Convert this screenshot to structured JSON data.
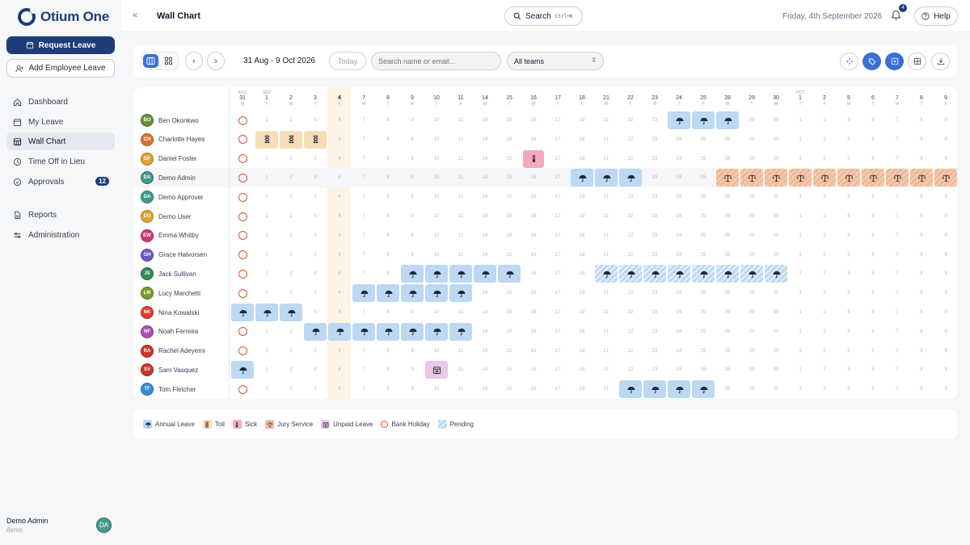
{
  "app": {
    "name": "Otium One"
  },
  "sidebar": {
    "request_leave": "Request Leave",
    "add_employee_leave": "Add Employee Leave",
    "nav": [
      {
        "id": "dashboard",
        "label": "Dashboard",
        "icon": "home-icon"
      },
      {
        "id": "my-leave",
        "label": "My Leave",
        "icon": "calendar-icon"
      },
      {
        "id": "wall-chart",
        "label": "Wall Chart",
        "icon": "calendar-grid-icon",
        "active": true
      },
      {
        "id": "toil",
        "label": "Time Off in Lieu",
        "icon": "clock-icon"
      },
      {
        "id": "approvals",
        "label": "Approvals",
        "icon": "check-circle-icon",
        "badge": "12"
      },
      {
        "id": "reports",
        "label": "Reports",
        "icon": "document-icon"
      },
      {
        "id": "administration",
        "label": "Administration",
        "icon": "sliders-icon"
      }
    ],
    "user": {
      "name": "Demo Admin",
      "sub": "demo",
      "initials": "DA"
    }
  },
  "header": {
    "title": "Wall Chart",
    "search_label": "Search",
    "search_shortcut": "Ctrl+K",
    "date": "Friday, 4th September 2026",
    "notification_count": "4",
    "help_label": "Help"
  },
  "toolbar": {
    "range": "31 Aug - 9 Oct 2026",
    "today": "Today",
    "search_placeholder": "Search name or email...",
    "team_select": "All teams"
  },
  "colors": {
    "primary": "#1d3c78",
    "accent": "#3a6fd6",
    "annual": "#bcd8f3",
    "toil": "#f7ddb5",
    "sick": "#f4a9bb",
    "jury": "#f6c9ad",
    "unpaid": "#e7c9e6",
    "bank_holiday": "#d9562c",
    "today_column": "#fdf2e3"
  },
  "days": [
    {
      "mon": "AUG",
      "d": "31",
      "w": "M",
      "bh": true
    },
    {
      "mon": "SEP",
      "d": "1",
      "w": "T"
    },
    {
      "mon": "",
      "d": "2",
      "w": "W"
    },
    {
      "mon": "",
      "d": "3",
      "w": "T"
    },
    {
      "mon": "",
      "d": "4",
      "w": "F",
      "today": true
    },
    {
      "mon": "",
      "d": "7",
      "w": "M"
    },
    {
      "mon": "",
      "d": "8",
      "w": "T"
    },
    {
      "mon": "",
      "d": "9",
      "w": "W"
    },
    {
      "mon": "",
      "d": "10",
      "w": "T"
    },
    {
      "mon": "",
      "d": "11",
      "w": "F"
    },
    {
      "mon": "",
      "d": "14",
      "w": "M"
    },
    {
      "mon": "",
      "d": "15",
      "w": "T"
    },
    {
      "mon": "",
      "d": "16",
      "w": "W"
    },
    {
      "mon": "",
      "d": "17",
      "w": "T"
    },
    {
      "mon": "",
      "d": "18",
      "w": "F"
    },
    {
      "mon": "",
      "d": "21",
      "w": "M"
    },
    {
      "mon": "",
      "d": "22",
      "w": "T"
    },
    {
      "mon": "",
      "d": "23",
      "w": "W"
    },
    {
      "mon": "",
      "d": "24",
      "w": "T"
    },
    {
      "mon": "",
      "d": "25",
      "w": "F"
    },
    {
      "mon": "",
      "d": "28",
      "w": "M"
    },
    {
      "mon": "",
      "d": "29",
      "w": "T"
    },
    {
      "mon": "",
      "d": "30",
      "w": "W"
    },
    {
      "mon": "OCT",
      "d": "1",
      "w": "T"
    },
    {
      "mon": "",
      "d": "2",
      "w": "F"
    },
    {
      "mon": "",
      "d": "5",
      "w": "M"
    },
    {
      "mon": "",
      "d": "6",
      "w": "T"
    },
    {
      "mon": "",
      "d": "7",
      "w": "W"
    },
    {
      "mon": "",
      "d": "8",
      "w": "T"
    },
    {
      "mon": "",
      "d": "9",
      "w": "F"
    }
  ],
  "employees": [
    {
      "name": "Ben Okonkwo",
      "initials": "BO",
      "color": "#6b8e3a",
      "leave": {
        "annual": [
          18,
          19,
          20
        ]
      }
    },
    {
      "name": "Charlotte Hayes",
      "initials": "CH",
      "color": "#d9762c",
      "leave": {
        "toil": [
          1,
          2,
          3
        ]
      }
    },
    {
      "name": "Daniel Foster",
      "initials": "DF",
      "color": "#e0a233",
      "leave": {
        "sick": [
          12
        ]
      }
    },
    {
      "name": "Demo Admin",
      "initials": "DA",
      "color": "#3f9a8c",
      "leave": {
        "annual": [
          14,
          15,
          16
        ],
        "jury": [
          20,
          21,
          22,
          23,
          24,
          25,
          26,
          27,
          28,
          29
        ]
      }
    },
    {
      "name": "Demo Approver",
      "initials": "DA",
      "color": "#3f9a8c",
      "leave": {}
    },
    {
      "name": "Demo User",
      "initials": "DU",
      "color": "#e0a233",
      "leave": {}
    },
    {
      "name": "Emma Whitby",
      "initials": "EW",
      "color": "#d03a73",
      "leave": {}
    },
    {
      "name": "Grace Halvorsen",
      "initials": "GH",
      "color": "#6d5bc9",
      "leave": {}
    },
    {
      "name": "Jack Sullivan",
      "initials": "JS",
      "color": "#2f8f57",
      "leave": {
        "annual": [
          7,
          8,
          9,
          10,
          11
        ],
        "pending": [
          15,
          16,
          17,
          18,
          19,
          20,
          21,
          22
        ]
      }
    },
    {
      "name": "Lucy Marchetti",
      "initials": "LM",
      "color": "#7a9a33",
      "leave": {
        "annual": [
          5,
          6,
          7,
          8,
          9
        ]
      }
    },
    {
      "name": "Nina Kowalski",
      "initials": "NK",
      "color": "#d9412c",
      "leave": {
        "annual": [
          0,
          1,
          2
        ]
      }
    },
    {
      "name": "Noah Ferreira",
      "initials": "NF",
      "color": "#b04fb0",
      "leave": {
        "annual": [
          3,
          4,
          5,
          6,
          7,
          8,
          9
        ]
      }
    },
    {
      "name": "Rachel Adeyemi",
      "initials": "RA",
      "color": "#c9362c",
      "leave": {}
    },
    {
      "name": "Sam Vasquez",
      "initials": "SV",
      "color": "#c9362c",
      "leave": {
        "annual": [
          0
        ],
        "unpaid": [
          8
        ]
      }
    },
    {
      "name": "Tom Fletcher",
      "initials": "TF",
      "color": "#3a8ad6",
      "leave": {
        "annual": [
          16,
          17,
          18,
          19
        ]
      }
    }
  ],
  "legend": [
    {
      "label": "Annual Leave",
      "kind": "annual"
    },
    {
      "label": "Toil",
      "kind": "toil"
    },
    {
      "label": "Sick",
      "kind": "sick"
    },
    {
      "label": "Jury Service",
      "kind": "jury"
    },
    {
      "label": "Unpaid Leave",
      "kind": "unpaid"
    },
    {
      "label": "Bank Holiday",
      "kind": "bh"
    },
    {
      "label": "Pending",
      "kind": "pending"
    }
  ]
}
